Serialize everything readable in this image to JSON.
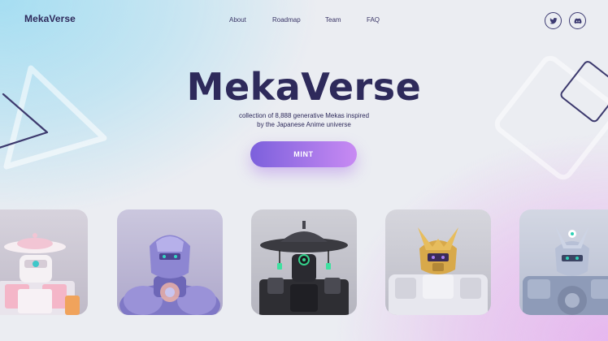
{
  "brand": {
    "logo": "MekaVerse"
  },
  "nav": {
    "items": [
      "About",
      "Roadmap",
      "Team",
      "FAQ"
    ]
  },
  "social": [
    {
      "name": "twitter-icon"
    },
    {
      "name": "discord-icon"
    }
  ],
  "hero": {
    "title": "MekaVerse",
    "subtitle_line1": "collection of 8,888 generative Mekas inspired",
    "subtitle_line2": "by the Japanese Anime universe",
    "cta": "MINT"
  },
  "colors": {
    "primary_text": "#2e2a5b",
    "button_start": "#7c60dc",
    "button_end": "#c88af3",
    "bg_top_left": "#a6def2",
    "bg_bottom_right": "#e6b7ee"
  },
  "gallery": [
    {
      "name": "meka-card-1",
      "theme": "white-pink hat robot"
    },
    {
      "name": "meka-card-2",
      "theme": "lavender armored robot"
    },
    {
      "name": "meka-card-3",
      "theme": "black hat robot"
    },
    {
      "name": "meka-card-4",
      "theme": "gold crest robot"
    },
    {
      "name": "meka-card-5",
      "theme": "blue-grey robot"
    }
  ]
}
